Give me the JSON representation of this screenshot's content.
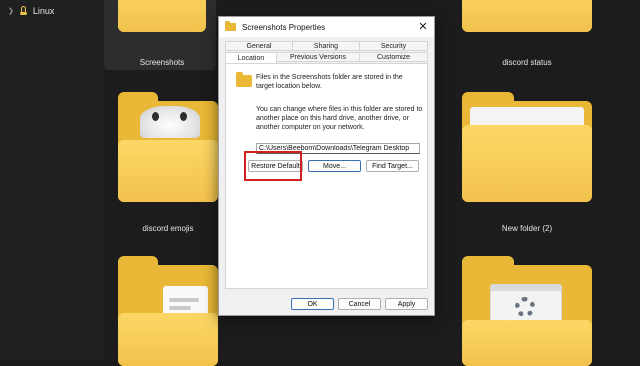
{
  "nav": {
    "linux_label": "Linux",
    "linux_icon": "linux-icon"
  },
  "folders": {
    "screenshots": "Screenshots",
    "discord_status": "discord status",
    "discord_emojis": "discord emojis",
    "new_folder_2": "New folder (2)"
  },
  "dialog": {
    "title": "Screenshots Properties",
    "close_glyph": "✕",
    "tabs_row1": [
      "General",
      "Sharing",
      "Security"
    ],
    "tabs_row2": [
      "Location",
      "Previous Versions",
      "Customize"
    ],
    "active_tab": "Location",
    "info_text": "Files in the Screenshots folder are stored in the target location below.",
    "description": "You can change where files in this folder are stored to another place on this hard drive, another drive, or another computer on your network.",
    "path_value": "C:\\Users\\Beebom\\Downloads\\Telegram Desktop",
    "buttons": {
      "restore_default": "Restore Default",
      "move": "Move...",
      "find_target": "Find Target..."
    },
    "footer": {
      "ok": "OK",
      "cancel": "Cancel",
      "apply": "Apply"
    }
  },
  "colors": {
    "highlight_box": "#d21f1f",
    "folder_yellow": "#f2c24d",
    "dark_bg": "#1c1c1c"
  }
}
